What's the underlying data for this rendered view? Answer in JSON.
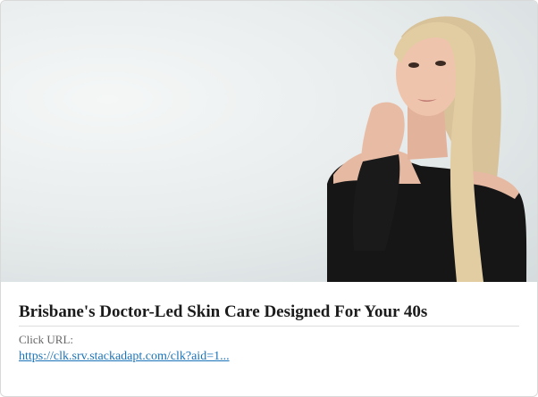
{
  "ad": {
    "image_subject": "woman-portrait",
    "headline": "Brisbane's Doctor-Led Skin Care Designed For Your 40s",
    "click_url_label": "Click URL:",
    "click_url": "https://clk.srv.stackadapt.com/clk?aid=1..."
  },
  "colors": {
    "link": "#1a73b8",
    "title": "#1b1b1b",
    "label": "#666666",
    "background": "#e9eded"
  }
}
